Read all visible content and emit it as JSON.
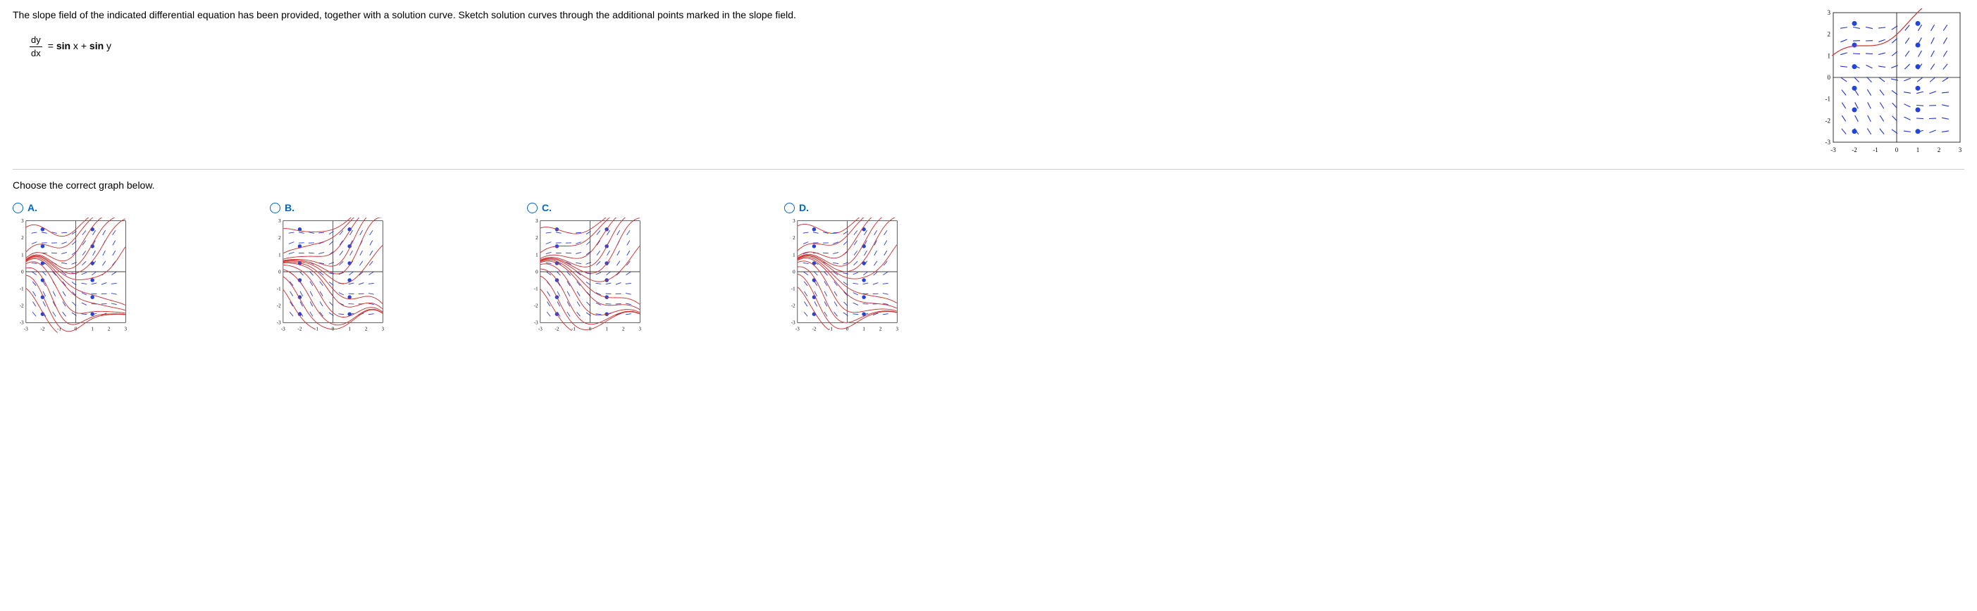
{
  "question": {
    "intro": "The slope field of the indicated differential equation has been provided, together with a solution curve. Sketch solution curves through the additional points marked in the slope field.",
    "equation": {
      "numerator": "dy",
      "denominator": "dx",
      "rhs_prefix": " = ",
      "rhs_bold": "sin",
      "rhs_x": " x + ",
      "rhs_bold2": "sin",
      "rhs_y": " y"
    }
  },
  "prompt": "Choose the correct graph below.",
  "axis_ticks": [
    "-3",
    "-2",
    "-1",
    "0",
    "1",
    "2",
    "3"
  ],
  "choices": {
    "a": "A.",
    "b": "B.",
    "c": "C.",
    "d": "D."
  },
  "marked_points": [
    {
      "x": -2,
      "y": 2.5
    },
    {
      "x": 1,
      "y": 2.5
    },
    {
      "x": -2,
      "y": 1.5
    },
    {
      "x": 1,
      "y": 1.5
    },
    {
      "x": -2,
      "y": 0.5
    },
    {
      "x": 1,
      "y": 0.5
    },
    {
      "x": -2,
      "y": -0.5
    },
    {
      "x": 1,
      "y": -0.5
    },
    {
      "x": -2,
      "y": -1.5
    },
    {
      "x": 1,
      "y": -1.5
    },
    {
      "x": -2,
      "y": -2.5
    },
    {
      "x": 1,
      "y": -2.5
    }
  ],
  "chart_data": {
    "type": "slope_field",
    "equation": "dy/dx = sin(x) + sin(y)",
    "xlim": [
      -3,
      3
    ],
    "ylim": [
      -3,
      3
    ],
    "main_solution_curve": "horizontal-ish curve through the field near y≈1 (red)",
    "marked_points": [
      [
        -2,
        2.5
      ],
      [
        1,
        2.5
      ],
      [
        -2,
        1.5
      ],
      [
        1,
        1.5
      ],
      [
        -2,
        0.5
      ],
      [
        1,
        0.5
      ],
      [
        -2,
        -0.5
      ],
      [
        1,
        -0.5
      ],
      [
        -2,
        -1.5
      ],
      [
        1,
        -1.5
      ],
      [
        -2,
        -2.5
      ],
      [
        1,
        -2.5
      ]
    ],
    "answer_choices": [
      "A",
      "B",
      "C",
      "D"
    ],
    "description": "Each choice shows the same slope field with candidate solution curves (red) passing through the marked blue points; the options differ in the paths of those curves."
  }
}
